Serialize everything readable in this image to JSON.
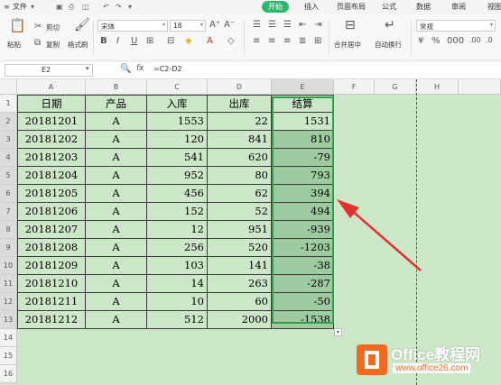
{
  "menu": {
    "file": "文件",
    "tabs": [
      "开始",
      "插入",
      "页面布局",
      "公式",
      "数据",
      "审阅",
      "视图"
    ]
  },
  "ribbon": {
    "paste": "粘贴",
    "cut": "剪切",
    "copy": "复制",
    "format_painter": "格式刷",
    "font": "宋体",
    "size": "18",
    "bold": "B",
    "italic": "I",
    "underline": "U",
    "merge": "合并居中",
    "wrap": "自动换行",
    "number_format": "常规"
  },
  "formula_bar": {
    "cell": "E2",
    "fx": "fx",
    "formula": "=C2-D2"
  },
  "columns": [
    "A",
    "B",
    "C",
    "D",
    "E",
    "F",
    "G",
    "H"
  ],
  "rows": [
    "1",
    "2",
    "3",
    "4",
    "5",
    "6",
    "7",
    "8",
    "9",
    "10",
    "11",
    "12",
    "13",
    "14",
    "15",
    "16"
  ],
  "table": {
    "headers": [
      "日期",
      "产品",
      "入库",
      "出库",
      "结算"
    ],
    "rows": [
      [
        "20181201",
        "A",
        "1553",
        "22",
        "1531"
      ],
      [
        "20181202",
        "A",
        "120",
        "841",
        "810"
      ],
      [
        "20181203",
        "A",
        "541",
        "620",
        "-79"
      ],
      [
        "20181204",
        "A",
        "952",
        "80",
        "793"
      ],
      [
        "20181205",
        "A",
        "456",
        "62",
        "394"
      ],
      [
        "20181206",
        "A",
        "152",
        "52",
        "494"
      ],
      [
        "20181207",
        "A",
        "12",
        "951",
        "-939"
      ],
      [
        "20181208",
        "A",
        "256",
        "520",
        "-1203"
      ],
      [
        "20181209",
        "A",
        "103",
        "141",
        "-38"
      ],
      [
        "20181210",
        "A",
        "14",
        "263",
        "-287"
      ],
      [
        "20181211",
        "A",
        "10",
        "60",
        "-50"
      ],
      [
        "20181212",
        "A",
        "512",
        "2000",
        "-1538"
      ]
    ]
  },
  "watermark": {
    "brand": "Office教程网",
    "url": "www.office26.com"
  },
  "colors": {
    "accent": "#2fb86b",
    "arrow": "#e5312e",
    "logo": "#f26a21",
    "sheet_bg": "#cde8c8",
    "selection": "#2ea04a"
  }
}
